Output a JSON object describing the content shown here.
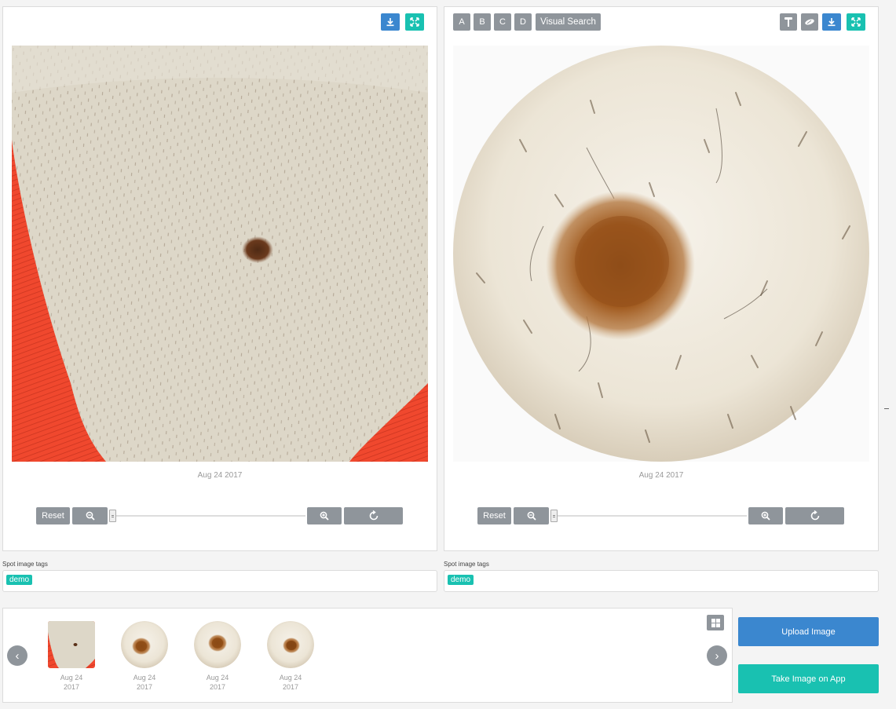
{
  "left_viewer": {
    "caption": "Aug 24 2017",
    "reset_label": "Reset",
    "download_icon": "download-icon",
    "fullscreen_icon": "fullscreen-icon"
  },
  "right_viewer": {
    "caption": "Aug 24 2017",
    "reset_label": "Reset",
    "overlay_buttons": [
      "A",
      "B",
      "C",
      "D"
    ],
    "visual_search_label": "Visual Search",
    "tool_icons": [
      "dermatoscope-icon",
      "pill-icon",
      "download-icon",
      "fullscreen-icon"
    ]
  },
  "tags": {
    "left": {
      "label": "Spot image tags",
      "tags": [
        "demo"
      ]
    },
    "right": {
      "label": "Spot image tags",
      "tags": [
        "demo"
      ]
    }
  },
  "timeline": {
    "prev_icon": "‹",
    "next_icon": "›",
    "grid_icon": "grid-icon",
    "thumbnails": [
      {
        "date_line1": "Aug 24",
        "date_line2": "2017",
        "kind": "clinical"
      },
      {
        "date_line1": "Aug 24",
        "date_line2": "2017",
        "kind": "dermoscopic"
      },
      {
        "date_line1": "Aug 24",
        "date_line2": "2017",
        "kind": "dermoscopic"
      },
      {
        "date_line1": "Aug 24",
        "date_line2": "2017",
        "kind": "dermoscopic"
      }
    ]
  },
  "actions": {
    "upload_label": "Upload Image",
    "take_label": "Take Image on App"
  },
  "colors": {
    "primary_blue": "#3b87cf",
    "teal": "#19c1b1",
    "gray_button": "#8f959b",
    "shirt_red": "#f0482e",
    "skin": "#ddd7c8",
    "lesion_brown": "#9a531c"
  }
}
